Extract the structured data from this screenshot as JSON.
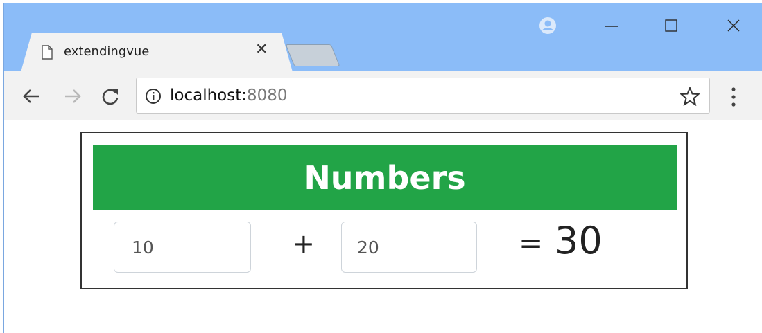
{
  "browser": {
    "tab": {
      "title": "extendingvue",
      "close_glyph": "✕",
      "icon": "page-icon"
    },
    "controls": {
      "profile_icon": "profile-icon",
      "minimize_icon": "minimize-icon",
      "maximize_icon": "maximize-icon",
      "close_icon": "close-icon"
    },
    "toolbar": {
      "back_icon": "back-arrow-icon",
      "forward_icon": "forward-arrow-icon",
      "reload_icon": "reload-icon",
      "url_host": "localhost:",
      "url_port": "8080",
      "info_icon": "info-icon",
      "bookmark_icon": "star-icon",
      "menu_icon": "kebab-menu-icon"
    },
    "colors": {
      "titlebar": "#8bbcf8",
      "toolbar": "#f2f2f2"
    }
  },
  "app": {
    "heading": "Numbers",
    "first_value": "10",
    "operator": "+",
    "second_value": "20",
    "equals": "=",
    "result": "30",
    "colors": {
      "banner": "#22a447",
      "banner_text": "#ffffff"
    }
  }
}
